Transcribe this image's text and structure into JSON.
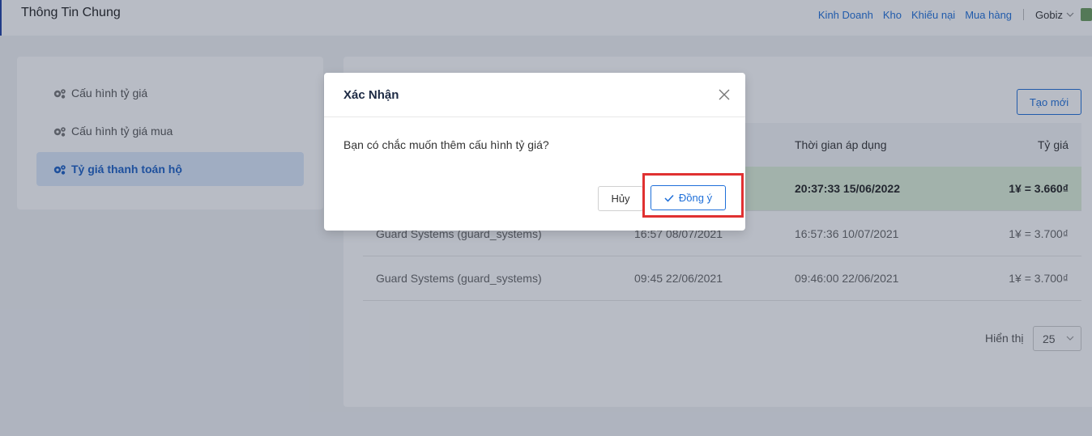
{
  "header": {
    "title": "Thông Tin Chung",
    "nav": [
      "Kinh Doanh",
      "Kho",
      "Khiếu nại",
      "Mua hàng"
    ],
    "user": "Gobiz"
  },
  "sidebar": {
    "items": [
      {
        "label": "Cấu hình tỷ giá",
        "icon": "gears-icon"
      },
      {
        "label": "Cấu hình tỷ giá mua",
        "icon": "gears-icon"
      },
      {
        "label": "Tỷ giá thanh toán hộ",
        "icon": "gears-icon",
        "active": true
      }
    ]
  },
  "main": {
    "create_button": "Tạo mới",
    "columns": {
      "applied_time": "Thời gian áp dụng",
      "rate": "Tỷ giá"
    },
    "rows": [
      {
        "name": "",
        "created": "",
        "applied": "20:37:33 15/06/2022",
        "rate": "1¥ = 3.660₫",
        "highlight": true
      },
      {
        "name": "Guard Systems (guard_systems)",
        "created": "16:57 08/07/2021",
        "applied": "16:57:36 10/07/2021",
        "rate": "1¥ = 3.700₫"
      },
      {
        "name": "Guard Systems (guard_systems)",
        "created": "09:45 22/06/2021",
        "applied": "09:46:00 22/06/2021",
        "rate": "1¥ = 3.700₫"
      }
    ],
    "pagination": {
      "label": "Hiển thị",
      "page_size": "25"
    }
  },
  "modal": {
    "title": "Xác Nhận",
    "message": "Bạn có chắc muốn thêm cấu hình tỷ giá?",
    "cancel_label": "Hủy",
    "ok_label": "Đồng ý"
  },
  "colors": {
    "accent": "#1e6fd9",
    "highlight_row": "#dff0d8",
    "annotation_box": "#e03131"
  }
}
